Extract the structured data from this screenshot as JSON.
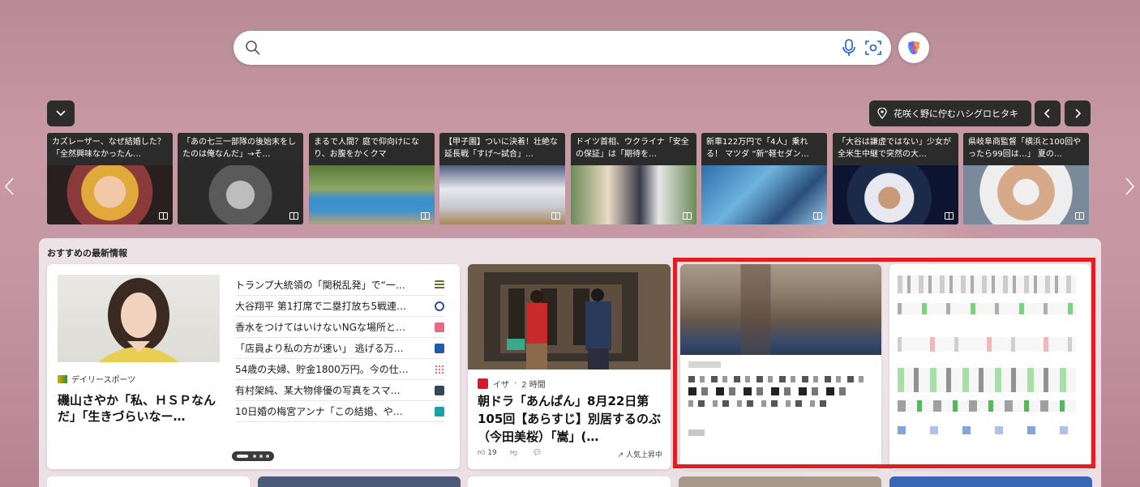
{
  "search": {
    "placeholder": "",
    "value": ""
  },
  "location_button": {
    "label": "花咲く野に佇むハシグロヒタキ"
  },
  "headlines": [
    {
      "title": "カズレーザー、なぜ結婚した？「全然興味なかったん…"
    },
    {
      "title": "「あの七三一部隊の後始末をしたのは俺なんだ」→そ…"
    },
    {
      "title": "まるで人間？庭で仰向けになり、お腹をかくクマ"
    },
    {
      "title": "【甲子園】ついに決着！壮絶な延長戦「すげ～試合」…"
    },
    {
      "title": "ドイツ首相、ウクライナ「安全の保証」は「期待を…"
    },
    {
      "title": "新車122万円で「4人」乗れる！ マツダ “新”軽セダン…"
    },
    {
      "title": "「大谷は謙虚ではない」少女が全米生中継で突然の大…"
    },
    {
      "title": "県岐阜商監督「横浜と100回やったら99回は…」 夏の…"
    }
  ],
  "feed": {
    "title": "おすすめの最新情報",
    "card1": {
      "source": "デイリースポーツ",
      "headline": "磯山さやか「私、ＨＳＰなんだ」「生きづらいなー…",
      "list": [
        "トランプ大統領の「関税乱発」で“一…",
        "大谷翔平 第1打席で二塁打放ち5戦連…",
        "香水をつけてはいけないNGな場所と…",
        "「店員より私の方が速い」 逃げる万…",
        "54歳の夫婦、貯金1800万円。今の仕…",
        "有村架純、某大物俳優の写真をスマ…",
        "10日婚の梅宮アンナ「この結婚、や…"
      ]
    },
    "card2": {
      "source": "イザ",
      "time": "2 時間",
      "headline": "朝ドラ「あんぱん」8月22日第105回【あらすじ】別居するのぶ（今田美桜）「嵩」(…",
      "likes": "19",
      "trend": "人気上昇中"
    }
  }
}
